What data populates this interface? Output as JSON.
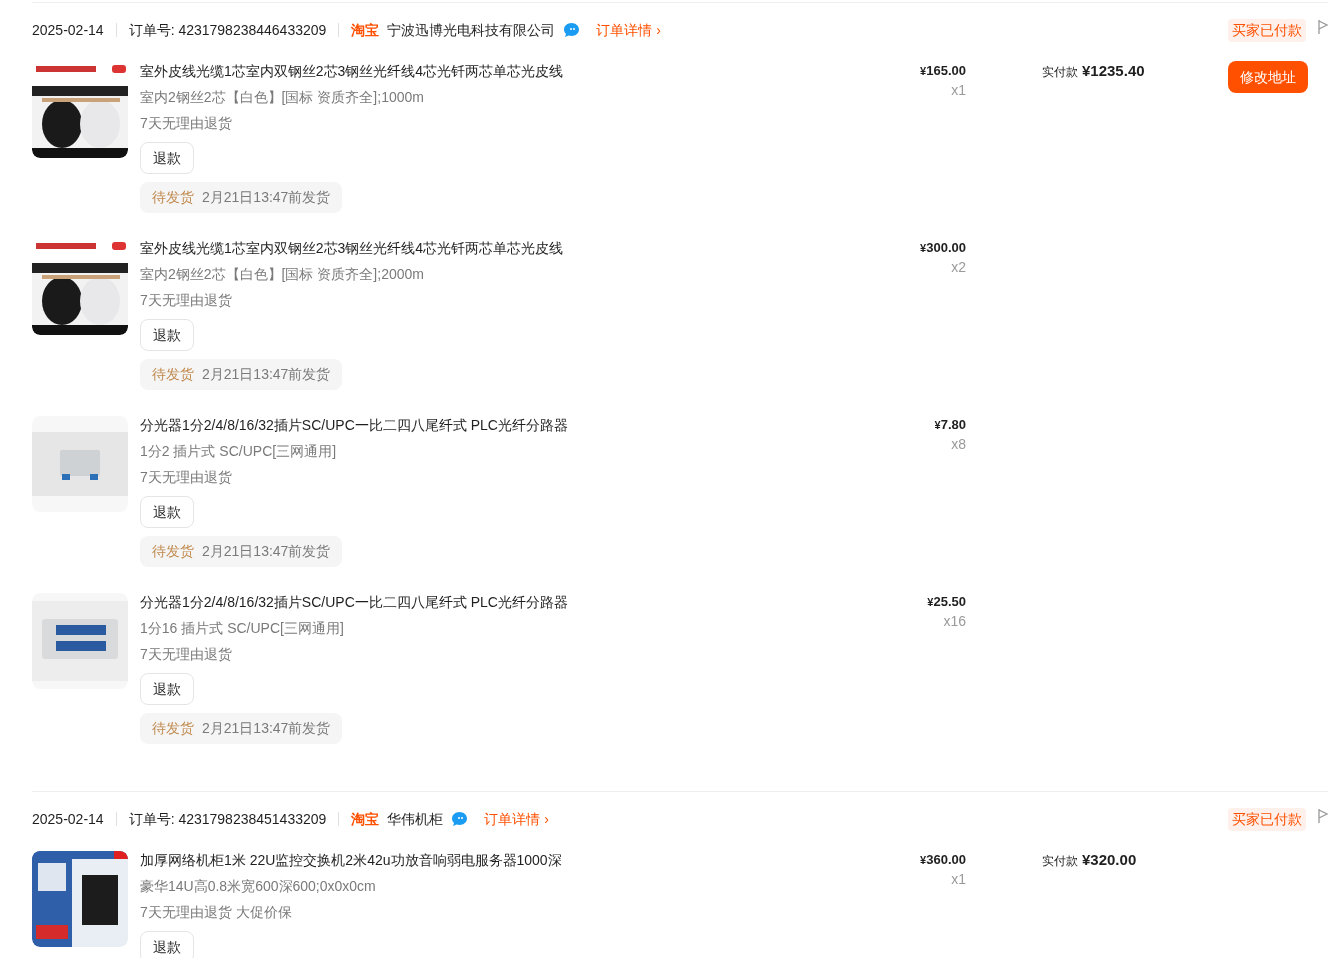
{
  "orders": [
    {
      "date": "2025-02-14",
      "order_no": "订单号: 4231798238446433209",
      "platform": "淘宝",
      "shop": "宁波迅博光电科技有限公司",
      "detail_link": "订单详情",
      "detail_arrow": "›",
      "status": "买家已付款",
      "paid_label": "实付款",
      "paid_amount": "¥1235.40",
      "action": "修改地址",
      "items": [
        {
          "kind": "cable",
          "title": "室外皮线光缆1芯室内双钢丝2芯3钢丝光纤线4芯光钎两芯单芯光皮线",
          "spec": "室内2钢丝2芯【白色】[国标 资质齐全];1000m",
          "service": "7天无理由退货",
          "price": "¥165.00",
          "qty": "x1",
          "refund": "退款",
          "ship_status": "待发货",
          "ship_note": "2月21日13:47前发货"
        },
        {
          "kind": "cable",
          "title": "室外皮线光缆1芯室内双钢丝2芯3钢丝光纤线4芯光钎两芯单芯光皮线",
          "spec": "室内2钢丝2芯【白色】[国标 资质齐全];2000m",
          "service": "7天无理由退货",
          "price": "¥300.00",
          "qty": "x2",
          "refund": "退款",
          "ship_status": "待发货",
          "ship_note": "2月21日13:47前发货"
        },
        {
          "kind": "splitter",
          "title": "分光器1分2/4/8/16/32插片SC/UPC一比二四八尾纤式 PLC光纤分路器",
          "spec": "1分2 插片式 SC/UPC[三网通用]",
          "service": "7天无理由退货",
          "price": "¥7.80",
          "qty": "x8",
          "refund": "退款",
          "ship_status": "待发货",
          "ship_note": "2月21日13:47前发货"
        },
        {
          "kind": "splitter16",
          "title": "分光器1分2/4/8/16/32插片SC/UPC一比二四八尾纤式 PLC光纤分路器",
          "spec": "1分16 插片式 SC/UPC[三网通用]",
          "service": "7天无理由退货",
          "price": "¥25.50",
          "qty": "x16",
          "refund": "退款",
          "ship_status": "待发货",
          "ship_note": "2月21日13:47前发货"
        }
      ]
    },
    {
      "date": "2025-02-14",
      "order_no": "订单号: 4231798238451433209",
      "platform": "淘宝",
      "shop": "华伟机柜",
      "detail_link": "订单详情",
      "detail_arrow": "›",
      "status": "买家已付款",
      "paid_label": "实付款",
      "paid_amount": "¥320.00",
      "items": [
        {
          "kind": "cabinet",
          "title": "加厚网络机柜1米 22U监控交换机2米42u功放音响弱电服务器1000深",
          "spec": "豪华14U高0.8米宽600深600;0x0x0cm",
          "service": "7天无理由退货 大促价保",
          "price": "¥360.00",
          "qty": "x1",
          "refund": "退款"
        }
      ]
    }
  ]
}
